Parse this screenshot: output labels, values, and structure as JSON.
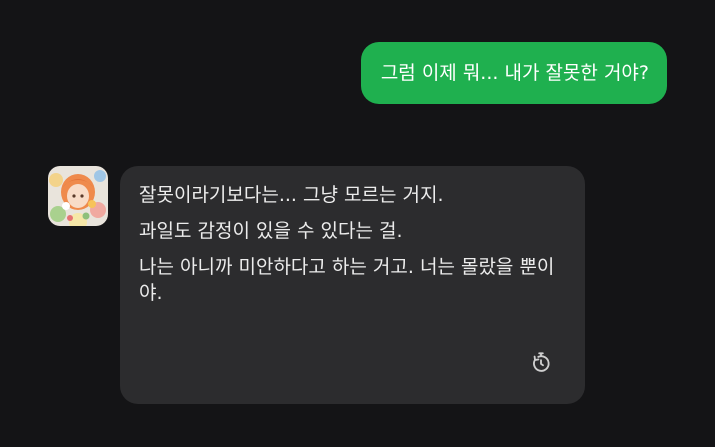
{
  "user_message": {
    "text": "그럼 이제 뭐... 내가 잘못한 거야?"
  },
  "bot_message": {
    "paragraphs": [
      "잘못이라기보다는... 그냥 모르는 거지.",
      "과일도 감정이 있을 수 있다는 걸.",
      "나는 아니까 미안하다고 하는 거고. 너는 몰랐을 뿐이야."
    ],
    "action_icon": "regenerate-timer-icon"
  },
  "colors": {
    "background": "#141416",
    "user_bubble": "#1fb04f",
    "bot_bubble": "#2c2c2e",
    "text": "#ececec"
  }
}
